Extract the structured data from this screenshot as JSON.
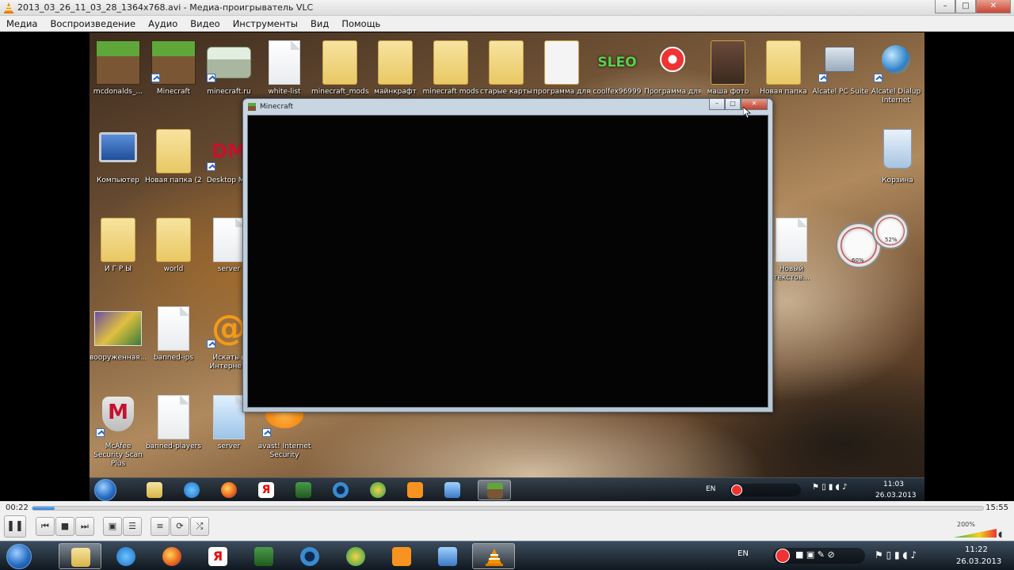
{
  "vlc": {
    "title": "2013_03_26_11_03_28_1364x768.avi - Медиа-проигрыватель VLC",
    "window_buttons": {
      "minimize": "–",
      "maximize": "□",
      "close": "✕"
    },
    "menu": [
      "Медиа",
      "Воспроизведение",
      "Аудио",
      "Видео",
      "Инструменты",
      "Вид",
      "Помощь"
    ],
    "time_current": "00:22",
    "time_total": "15:55",
    "progress": 0.023,
    "volume_label": "200%",
    "controls": {
      "pause": "❚❚",
      "prev": "⏮",
      "stop": "■",
      "next": "⏭",
      "fullscreen": "▣",
      "extended": "☰",
      "playlist": "≡",
      "loop": "⟳",
      "random": "⤮"
    }
  },
  "desktop_icons": [
    {
      "label": "mcdonalds_...",
      "type": "grass"
    },
    {
      "label": "Minecraft",
      "type": "grass"
    },
    {
      "label": "minecraft.ru",
      "type": "grass-light"
    },
    {
      "label": "white-list",
      "type": "paper"
    },
    {
      "label": "minecraft_mods",
      "type": "folder"
    },
    {
      "label": "майнкрафт",
      "type": "folder"
    },
    {
      "label": "minecraft mods",
      "type": "folder"
    },
    {
      "label": "старые карты",
      "type": "folder"
    },
    {
      "label": "программа для",
      "type": "folder"
    },
    {
      "label": "coolfex96999",
      "type": "app"
    },
    {
      "label": "Программа для",
      "type": "app"
    },
    {
      "label": "маша фото",
      "type": "folder"
    },
    {
      "label": "Новая папка",
      "type": "folder"
    },
    {
      "label": "Alcatel PC Suite",
      "type": "app"
    },
    {
      "label": "Alcatel Dialup Internet",
      "type": "app"
    },
    {
      "label": "Компьютер",
      "type": "monitor"
    },
    {
      "label": "Новая папка (2)",
      "type": "folder"
    },
    {
      "label": "Desktop M...",
      "type": "app"
    },
    {
      "label": "Корзина",
      "type": "bin"
    },
    {
      "label": "И Г Р Ы",
      "type": "folder"
    },
    {
      "label": "world",
      "type": "folder"
    },
    {
      "label": "server",
      "type": "paper"
    },
    {
      "label": "Новый текстов...",
      "type": "paper"
    },
    {
      "label": "вооруженная...",
      "type": "image"
    },
    {
      "label": "banned-ips",
      "type": "paper"
    },
    {
      "label": "Искать в Интерне...",
      "type": "app"
    },
    {
      "label": "McAfee Security Scan Plus",
      "type": "app"
    },
    {
      "label": "banned-players",
      "type": "paper"
    },
    {
      "label": "server",
      "type": "paper"
    },
    {
      "label": "avast! Internet Security",
      "type": "app"
    }
  ],
  "desktop_overlay_text": {
    "sleo": "SLEO",
    "dm": "DM"
  },
  "minecraft_window": {
    "title": "Minecraft",
    "buttons": {
      "minimize": "–",
      "maximize": "□",
      "close": "✕"
    }
  },
  "gadgets": {
    "cpu_small": "52%",
    "cpu_big": "60%"
  },
  "inner_taskbar": {
    "lang": "EN",
    "time": "11:03",
    "date": "26.03.2013",
    "yandex": "Я"
  },
  "outer_taskbar": {
    "lang": "EN",
    "time": "11:22",
    "date": "26.03.2013",
    "yandex": "Я"
  },
  "colors": {
    "accent": "#2b7fd6",
    "close": "#c94535"
  }
}
